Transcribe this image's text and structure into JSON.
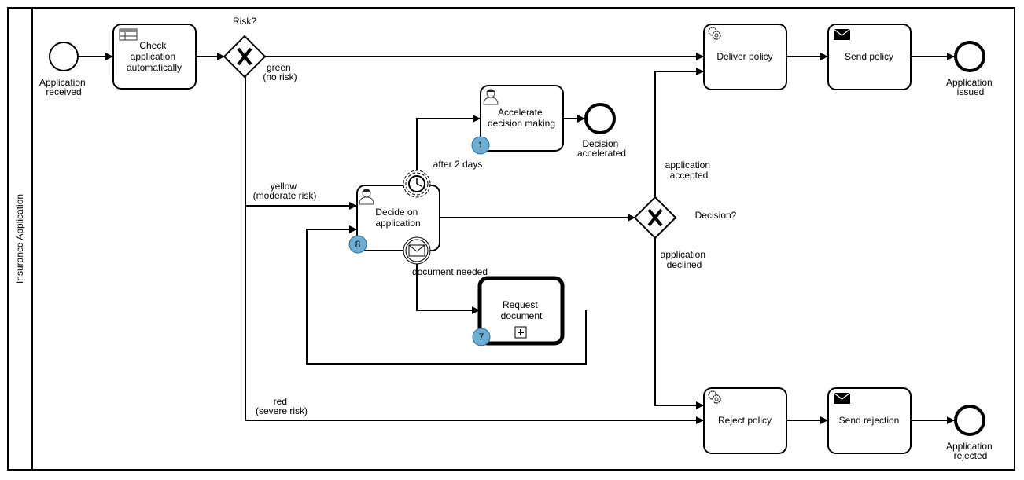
{
  "pool": {
    "label": "Insurance Application"
  },
  "start_event": {
    "label_lines": [
      "Application",
      "received"
    ]
  },
  "tasks": {
    "check": {
      "lines": [
        "Check",
        "application",
        "automatically"
      ],
      "type": "business-rule"
    },
    "accelerate": {
      "lines": [
        "Accelerate",
        "decision making"
      ],
      "type": "user",
      "badge": "1"
    },
    "decide": {
      "lines": [
        "Decide on",
        "application"
      ],
      "type": "user",
      "badge": "8"
    },
    "request": {
      "lines": [
        "Request",
        "document"
      ],
      "type": "call-activity-subprocess",
      "badge": "7"
    },
    "deliver": {
      "lines": [
        "Deliver policy"
      ],
      "type": "service"
    },
    "send_policy": {
      "lines": [
        "Send policy"
      ],
      "type": "send"
    },
    "reject": {
      "lines": [
        "Reject policy"
      ],
      "type": "service"
    },
    "send_rejection": {
      "lines": [
        "Send rejection"
      ],
      "type": "send"
    }
  },
  "gateways": {
    "risk": {
      "label": "Risk?",
      "type": "exclusive"
    },
    "decision": {
      "label": "Decision?",
      "type": "exclusive"
    }
  },
  "end_events": {
    "accelerated": {
      "label_lines": [
        "Decision",
        "accelerated"
      ]
    },
    "issued": {
      "label_lines": [
        "Application",
        "issued"
      ]
    },
    "rejected": {
      "label_lines": [
        "Application",
        "rejected"
      ]
    }
  },
  "boundary_events": {
    "timer": {
      "label": "after 2 days",
      "type": "timer"
    },
    "message": {
      "label": "document needed",
      "type": "message"
    }
  },
  "flow_labels": {
    "green": [
      "green",
      "(no risk)"
    ],
    "yellow": [
      "yellow",
      "(moderate risk)"
    ],
    "red": [
      "red",
      "(severe risk)"
    ],
    "accepted": [
      "application",
      "accepted"
    ],
    "declined": [
      "application",
      "declined"
    ]
  },
  "colors": {
    "badge_fill": "#6baed6",
    "stroke": "#000000"
  }
}
